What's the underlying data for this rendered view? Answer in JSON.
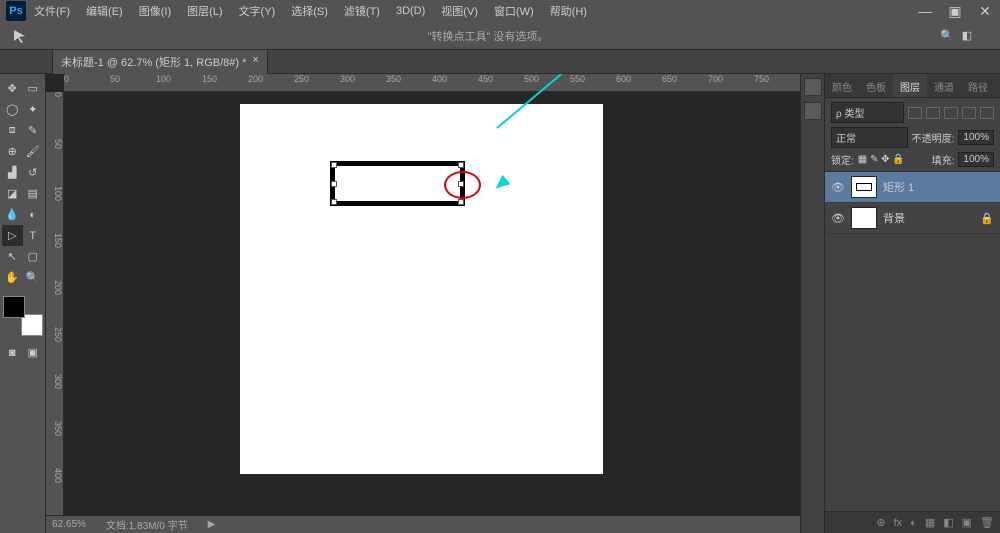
{
  "app": {
    "logo": "Ps"
  },
  "menubar": [
    "文件(F)",
    "编辑(E)",
    "图像(I)",
    "图层(L)",
    "文字(Y)",
    "选择(S)",
    "滤镜(T)",
    "3D(D)",
    "视图(V)",
    "窗口(W)",
    "帮助(H)"
  ],
  "window_controls": {
    "minimize": "—",
    "maximize": "▣",
    "close": "✕"
  },
  "options_bar": {
    "message": "\"转换点工具\" 没有选项。"
  },
  "tab": {
    "title": "未标题-1 @ 62.7% (矩形 1, RGB/8#) *",
    "close": "×"
  },
  "ruler_h": [
    "0",
    "50",
    "100",
    "150",
    "200",
    "250",
    "300",
    "350",
    "400",
    "450",
    "500",
    "550",
    "600",
    "650",
    "700",
    "750"
  ],
  "ruler_v": [
    "0",
    "50",
    "100",
    "150",
    "200",
    "250",
    "300",
    "350",
    "400"
  ],
  "status": {
    "zoom": "62.65%",
    "doc": "文档:1.83M/0 字节",
    "arrow": "▶"
  },
  "right_tabs": [
    "颜色",
    "色板",
    "图层",
    "通道",
    "路径"
  ],
  "layer_panel": {
    "kind": "ρ 类型",
    "blend": "正常",
    "opacity_label": "不透明度:",
    "opacity_val": "100%",
    "lock_label": "锁定:",
    "fill_label": "填充:",
    "fill_val": "100%",
    "layers": [
      {
        "name": "矩形 1",
        "selected": true
      },
      {
        "name": "背景",
        "selected": false,
        "locked": true
      }
    ]
  },
  "layer_footer_icons": [
    "⊕",
    "fx",
    "◐",
    "▦",
    "◧",
    "▣",
    "🗑"
  ]
}
